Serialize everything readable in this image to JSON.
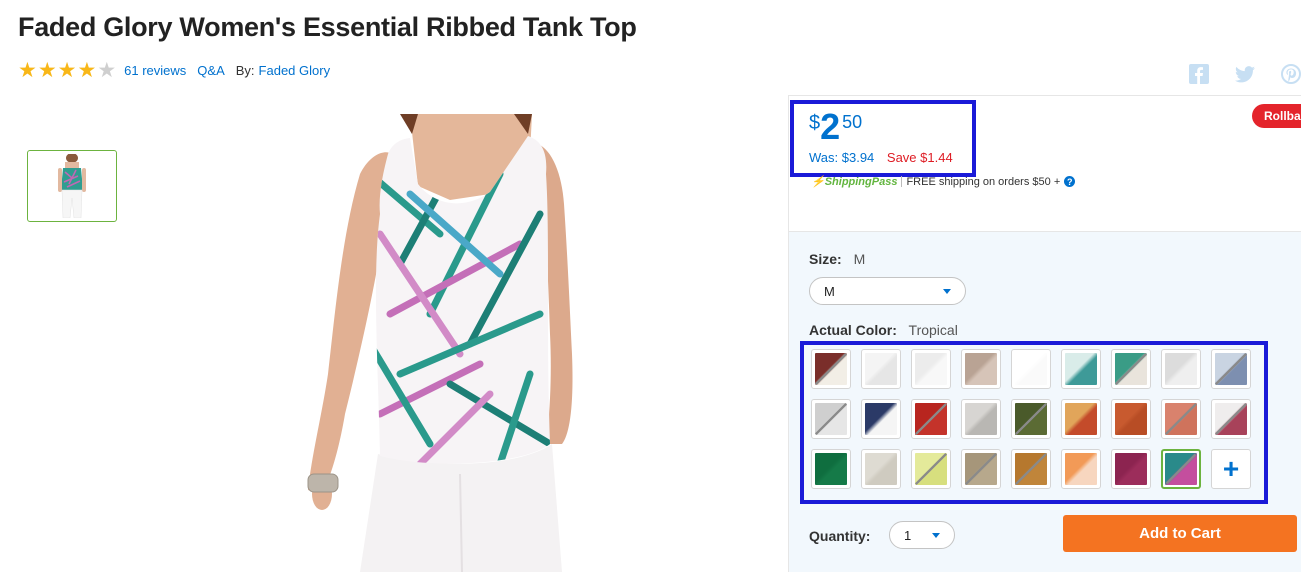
{
  "product": {
    "title": "Faded Glory Women's Essential Ribbed Tank Top",
    "rating": 4,
    "rating_max": 5,
    "reviews_label": "61 reviews",
    "qa_label": "Q&A",
    "by_label": "By:",
    "brand": "Faded Glory"
  },
  "price": {
    "currency": "$",
    "whole": "2",
    "cents": "50",
    "was": "Was: $3.94",
    "save": "Save $1.44",
    "badge": "Rollback"
  },
  "shipping": {
    "pass_label": "ShippingPass",
    "text": "FREE shipping on orders $50 +"
  },
  "size": {
    "label": "Size:",
    "value": "M",
    "selected": "M"
  },
  "color": {
    "label": "Actual Color:",
    "value": "Tropical",
    "swatches": [
      {
        "name": "stripe-navy-red",
        "c1": "#7a2e2a",
        "c2": "#f2eee6",
        "unavailable": true,
        "selected": false
      },
      {
        "name": "white-print",
        "c1": "#f4f4f4",
        "c2": "#e6e6e6",
        "unavailable": false,
        "selected": false
      },
      {
        "name": "white-rib",
        "c1": "#ececec",
        "c2": "#f8f8f8",
        "unavailable": false,
        "selected": false
      },
      {
        "name": "taupe-stripe",
        "c1": "#b9a394",
        "c2": "#d6c4b8",
        "unavailable": false,
        "selected": false
      },
      {
        "name": "white",
        "c1": "#ffffff",
        "c2": "#fafafa",
        "unavailable": false,
        "selected": false
      },
      {
        "name": "teal-leaf",
        "c1": "#d9ece9",
        "c2": "#3e9a98",
        "unavailable": false,
        "selected": false
      },
      {
        "name": "teal-ikat",
        "c1": "#3a9c86",
        "c2": "#e9e4dc",
        "unavailable": true,
        "selected": false
      },
      {
        "name": "light-grey",
        "c1": "#dcdcdc",
        "c2": "#efefef",
        "unavailable": false,
        "selected": false
      },
      {
        "name": "blue-floral",
        "c1": "#c9d4e2",
        "c2": "#7d8fb0",
        "unavailable": true,
        "selected": false
      },
      {
        "name": "grey-heather",
        "c1": "#cfcfcf",
        "c2": "#e6e6e6",
        "unavailable": true,
        "selected": false
      },
      {
        "name": "navy-white",
        "c1": "#2b3a67",
        "c2": "#f5f5f5",
        "unavailable": false,
        "selected": false
      },
      {
        "name": "red",
        "c1": "#b8251f",
        "c2": "#c4332a",
        "unavailable": true,
        "selected": false
      },
      {
        "name": "grey-camo",
        "c1": "#d7d5d2",
        "c2": "#b9b7b3",
        "unavailable": false,
        "selected": false
      },
      {
        "name": "olive",
        "c1": "#4a5a2a",
        "c2": "#5b6b34",
        "unavailable": true,
        "selected": false
      },
      {
        "name": "orange-ikat",
        "c1": "#e1a55a",
        "c2": "#c44b2a",
        "unavailable": false,
        "selected": false
      },
      {
        "name": "rust",
        "c1": "#c85a2f",
        "c2": "#b84d25",
        "unavailable": false,
        "selected": false
      },
      {
        "name": "coral",
        "c1": "#d9826d",
        "c2": "#cf735c",
        "unavailable": true,
        "selected": false
      },
      {
        "name": "white-floral",
        "c1": "#efeded",
        "c2": "#a8425a",
        "unavailable": true,
        "selected": false
      },
      {
        "name": "green",
        "c1": "#0f6e3f",
        "c2": "#157a48",
        "unavailable": false,
        "selected": false
      },
      {
        "name": "oatmeal",
        "c1": "#dedbd2",
        "c2": "#cfcbc0",
        "unavailable": false,
        "selected": false
      },
      {
        "name": "lime",
        "c1": "#e4ea9a",
        "c2": "#d7df7e",
        "unavailable": true,
        "selected": false
      },
      {
        "name": "khaki",
        "c1": "#a6967a",
        "c2": "#b7a88c",
        "unavailable": true,
        "selected": false
      },
      {
        "name": "mustard",
        "c1": "#b6782e",
        "c2": "#c0853a",
        "unavailable": true,
        "selected": false
      },
      {
        "name": "orange-stripe",
        "c1": "#f29a57",
        "c2": "#f7d6bf",
        "unavailable": false,
        "selected": false
      },
      {
        "name": "berry",
        "c1": "#8c2450",
        "c2": "#9c2d5b",
        "unavailable": false,
        "selected": false
      },
      {
        "name": "tropical",
        "c1": "#2a8a8a",
        "c2": "#c44e9e",
        "unavailable": true,
        "selected": true
      }
    ],
    "more_label": "+"
  },
  "quantity": {
    "label": "Quantity:",
    "value": "1"
  },
  "cta": {
    "add_to_cart": "Add to Cart"
  },
  "colors": {
    "accent_blue": "#0071ce",
    "cart_orange": "#f47321",
    "save_red": "#de1c24",
    "selection_green": "#6cb33f",
    "highlight_box": "#1a1ad8"
  },
  "social": {
    "icons": [
      "facebook-icon",
      "twitter-icon",
      "pinterest-icon"
    ]
  }
}
